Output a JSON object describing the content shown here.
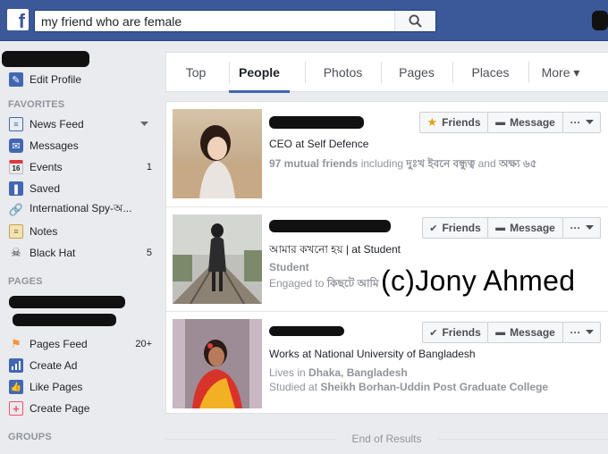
{
  "search": {
    "value": "my friend who are female"
  },
  "sidebar": {
    "edit_profile": "Edit Profile",
    "favorites_header": "FAVORITES",
    "favorites": [
      {
        "label": "News Feed",
        "count": "",
        "icon": "news-feed-icon",
        "color": "#4267b2"
      },
      {
        "label": "Messages",
        "count": "",
        "icon": "messages-icon",
        "color": "#4267b2"
      },
      {
        "label": "Events",
        "count": "1",
        "icon": "events-calendar-icon",
        "color": "#e0393e"
      },
      {
        "label": "Saved",
        "count": "",
        "icon": "saved-bookmark-icon",
        "color": "#4267b2"
      },
      {
        "label": "International Spy-অ...",
        "count": "",
        "icon": "link-icon",
        "color": "#7b93c4"
      },
      {
        "label": "Notes",
        "count": "",
        "icon": "notes-icon",
        "color": "#c9a24a"
      },
      {
        "label": "Black Hat",
        "count": "5",
        "icon": "skull-icon",
        "color": "#555555"
      }
    ],
    "pages_header": "PAGES",
    "pages": [
      {
        "label": "Pages Feed",
        "count": "20+",
        "icon": "pages-feed-flag-icon",
        "color": "#f7923a"
      },
      {
        "label": "Create Ad",
        "count": "",
        "icon": "create-ad-chart-icon",
        "color": "#4267b2"
      },
      {
        "label": "Like Pages",
        "count": "",
        "icon": "like-thumb-icon",
        "color": "#4267b2"
      },
      {
        "label": "Create Page",
        "count": "",
        "icon": "create-page-plus-icon",
        "color": "#f35369"
      }
    ],
    "groups_header": "GROUPS"
  },
  "tabs": [
    {
      "label": "Top"
    },
    {
      "label": "People"
    },
    {
      "label": "Photos"
    },
    {
      "label": "Pages"
    },
    {
      "label": "Places"
    },
    {
      "label": "More ▾"
    }
  ],
  "active_tab": "People",
  "results": [
    {
      "line1": "CEO at Self Defence",
      "mutual_count": "97 mutual friends",
      "mutual_rest": " including ",
      "mutual_names": "দুঃখ ইবনে বন্ধুত্ব",
      "mutual_and": " and ",
      "mutual_more": "অক্ষ্য ৬৫",
      "friends_label": "Friends",
      "friends_icon": "star-icon",
      "message_label": "Message",
      "more_label": "···"
    },
    {
      "line1": "আমার কখনো হয় | at Student",
      "line2": "Student",
      "line3_prefix": "Engaged to ",
      "line3_name": "কিছটে আমি",
      "friends_label": "Friends",
      "friends_icon": "check-icon",
      "message_label": "Message",
      "more_label": "···"
    },
    {
      "line1": "Works at National University of Bangladesh",
      "line2_prefix": "Lives in ",
      "line2_bold": "Dhaka, Bangladesh",
      "line3_prefix": "Studied at ",
      "line3_bold": "Sheikh Borhan-Uddin Post Graduate College",
      "friends_label": "Friends",
      "friends_icon": "check-icon",
      "message_label": "Message",
      "more_label": "···"
    }
  ],
  "watermark": "(c)Jony Ahmed",
  "end_of_results": "End of Results",
  "colors": {
    "brand": "#3b5998",
    "accent": "#4267b2",
    "muted": "#90949c"
  }
}
